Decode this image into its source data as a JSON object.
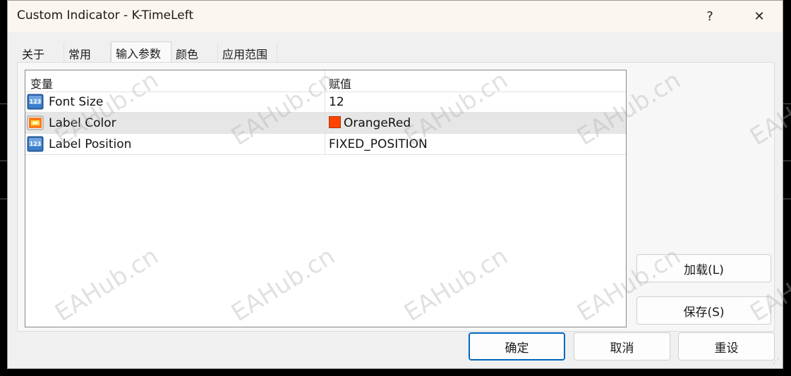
{
  "window": {
    "title": "Custom Indicator - K-TimeLeft",
    "help_label": "?",
    "close_label": "✕"
  },
  "tabs": [
    {
      "label": "关于"
    },
    {
      "label": "常用"
    },
    {
      "label": "输入参数",
      "active": true
    },
    {
      "label": "颜色"
    },
    {
      "label": "应用范围"
    }
  ],
  "params": {
    "col_variable": "变量",
    "col_value": "赋值",
    "rows": [
      {
        "icon": "numeric-123-icon",
        "name": "Font Size",
        "value": "12"
      },
      {
        "icon": "color-palette-icon",
        "name": "Label Color",
        "value": "OrangeRed",
        "swatch": "#ff4500",
        "selected": true
      },
      {
        "icon": "numeric-123-icon",
        "name": "Label Position",
        "value": "FIXED_POSITION"
      }
    ]
  },
  "side_buttons": {
    "load": "加载(L)",
    "save": "保存(S)"
  },
  "footer": {
    "ok": "确定",
    "cancel": "取消",
    "reset": "重设"
  },
  "watermark_text": "EAHub.cn",
  "colors": {
    "dialog_bg": "#f0f0f0",
    "titlebar_bg": "#fbf6ef",
    "accent": "#0067c0",
    "orangered": "#ff4500"
  }
}
